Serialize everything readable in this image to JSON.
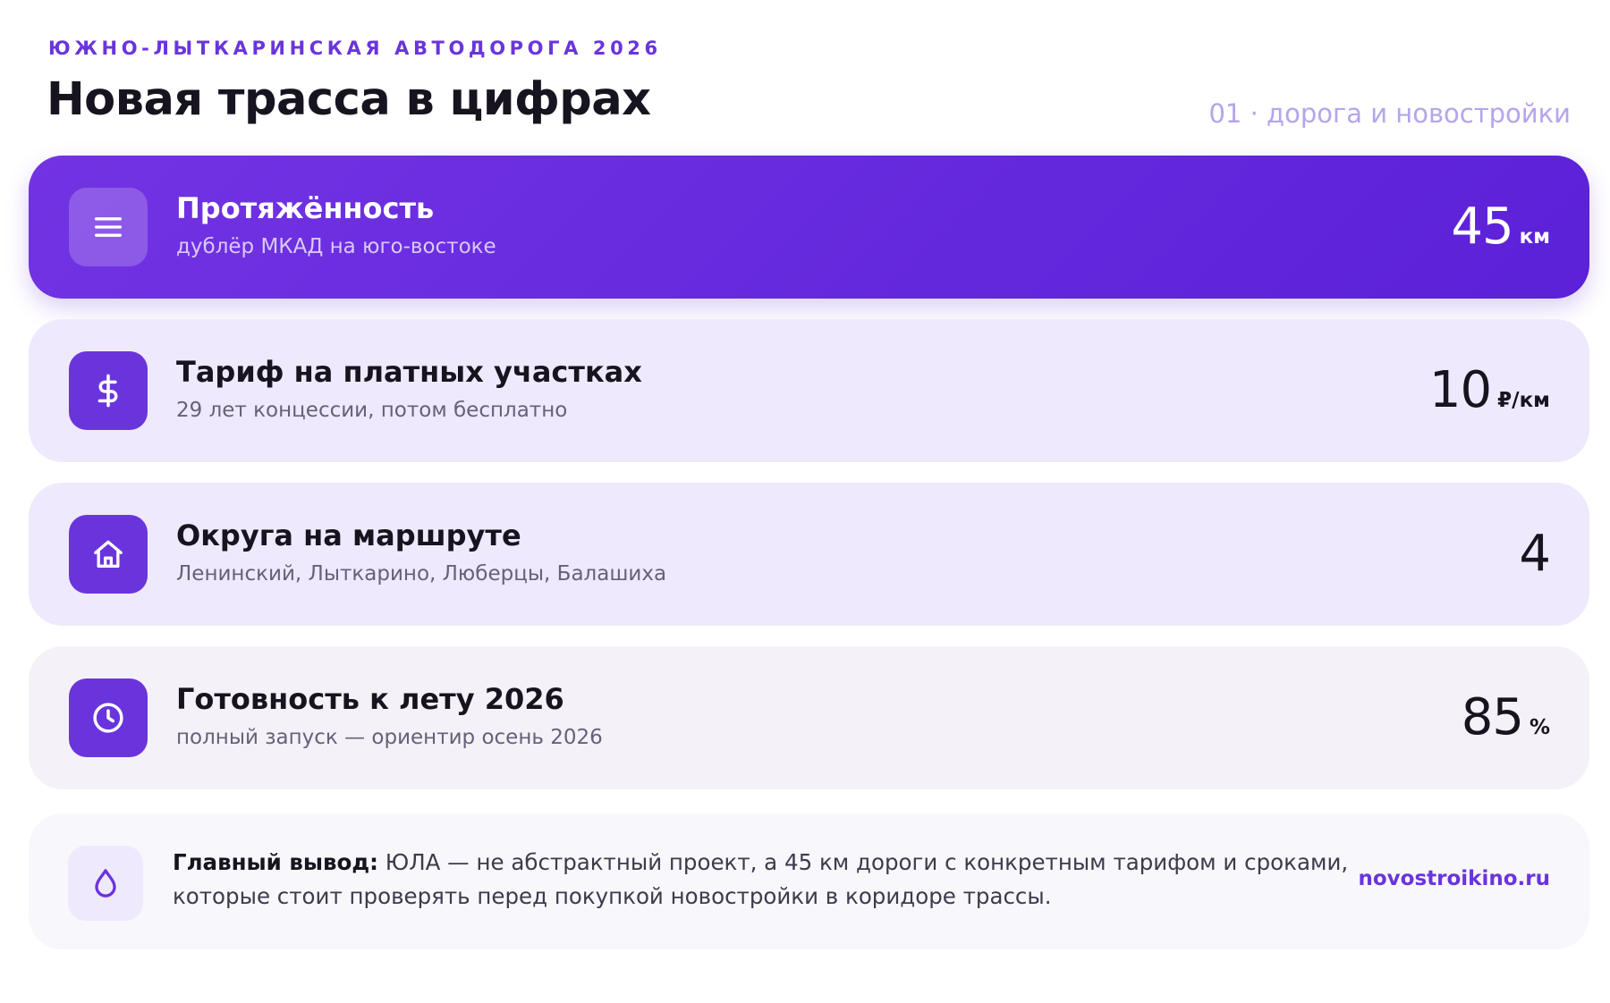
{
  "header": {
    "eyebrow": "ЮЖНО-ЛЫТКАРИНСКАЯ АВТОДОРОГА 2026",
    "title": "Новая трасса в цифрах",
    "page_indicator": "01 · дорога и новостройки"
  },
  "stats": [
    {
      "icon": "menu-icon",
      "title": "Протяжённость",
      "subtitle": "дублёр МКАД на юго-востоке",
      "value": "45",
      "unit": "км"
    },
    {
      "icon": "dollar-icon",
      "title": "Тариф на платных участках",
      "subtitle": "29 лет концессии, потом бесплатно",
      "value": "10",
      "unit": "₽/км"
    },
    {
      "icon": "home-icon",
      "title": "Округа на маршруте",
      "subtitle": "Ленинский, Лыткарино, Люберцы, Балашиха",
      "value": "4",
      "unit": ""
    },
    {
      "icon": "clock-icon",
      "title": "Готовность к лету 2026",
      "subtitle": "полный запуск — ориентир осень 2026",
      "value": "85",
      "unit": "%"
    }
  ],
  "conclusion": {
    "icon": "drop-icon",
    "label": "Главный вывод:",
    "text": " ЮЛА — не абстрактный проект, а 45 км дороги с конкретным тарифом и сроками, которые стоит проверять перед покупкой новостройки в коридоре трассы."
  },
  "source": {
    "label": "novostroikino.ru"
  },
  "colors": {
    "accent": "#6a34dd",
    "highlight_card_gradient_start": "#7233e3",
    "highlight_card_gradient_end": "#5b21d8",
    "card_background": "#efe9fd",
    "neutral_card_background": "#f4f2f8",
    "page_indicator": "#b6a4ec",
    "text_primary": "#17141f",
    "text_secondary": "#66617a"
  }
}
